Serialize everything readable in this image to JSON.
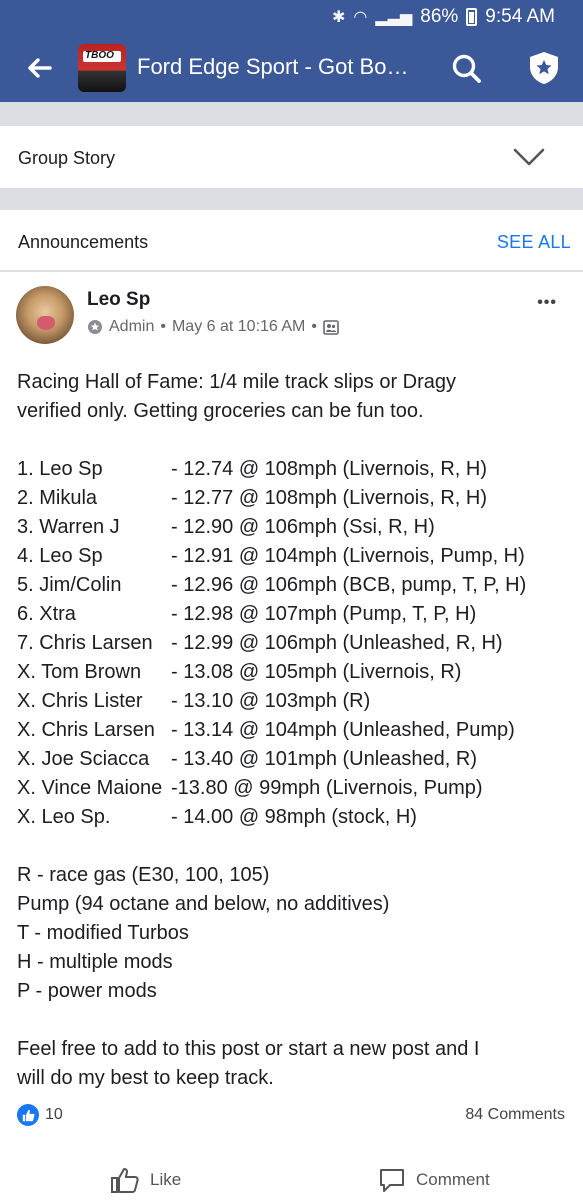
{
  "status_bar": {
    "battery": "86%",
    "time": "9:54 AM"
  },
  "header": {
    "title": "Ford Edge Sport - Got Bo…",
    "group_logo_text": "TBOO"
  },
  "group_story": {
    "label": "Group Story"
  },
  "announcements": {
    "label": "Announcements",
    "see_all": "SEE ALL"
  },
  "post": {
    "author": "Leo Sp",
    "role": "Admin",
    "separator": "•",
    "date": "May 6 at 10:16 AM",
    "more": "•••",
    "intro_1": "Racing Hall of Fame: 1/4 mile track slips or Dragy",
    "intro_2": "verified only. Getting groceries can be fun too.",
    "entries": [
      {
        "name": "1. Leo Sp",
        "result": "- 12.74 @ 108mph (Livernois, R, H)"
      },
      {
        "name": "2. Mikula",
        "result": "- 12.77 @ 108mph (Livernois, R, H)"
      },
      {
        "name": "3. Warren J",
        "result": "- 12.90 @ 106mph (Ssi, R, H)"
      },
      {
        "name": "4. Leo Sp",
        "result": "- 12.91 @ 104mph (Livernois, Pump, H)"
      },
      {
        "name": "5. Jim/Colin",
        "result": "- 12.96 @ 106mph (BCB, pump, T, P, H)"
      },
      {
        "name": "6. Xtra",
        "result": "- 12.98 @ 107mph (Pump, T, P, H)"
      },
      {
        "name": "7. Chris Larsen",
        "result": "- 12.99 @ 106mph (Unleashed, R, H)"
      },
      {
        "name": "X. Tom Brown",
        "result": "- 13.08 @ 105mph (Livernois, R)"
      },
      {
        "name": "X. Chris Lister",
        "result": "- 13.10 @ 103mph (R)"
      },
      {
        "name": "X. Chris Larsen",
        "result": "- 13.14 @ 104mph (Unleashed, Pump)"
      },
      {
        "name": "X. Joe Sciacca",
        "result": "- 13.40 @ 101mph (Unleashed, R)"
      },
      {
        "name": "X. Vince Maione",
        "result": "-13.80 @ 99mph (Livernois, Pump)"
      },
      {
        "name": "X. Leo Sp.",
        "result": "- 14.00 @ 98mph (stock, H)"
      }
    ],
    "legend": [
      "R - race gas (E30, 100, 105)",
      "Pump (94 octane and below, no additives)",
      "T - modified Turbos",
      "H - multiple mods",
      "P - power mods"
    ],
    "outro_1": "Feel free to add to this post or start a new post and I",
    "outro_2": "will do my best to keep track.",
    "like_count": "10",
    "comments_count": "84 Comments",
    "like_label": "Like",
    "comment_label": "Comment"
  },
  "icons": {
    "back": "arrow-left-icon",
    "search": "search-icon",
    "admin": "shield-star-icon",
    "dropdown": "chevron-down-icon",
    "privacy": "group-privacy-icon",
    "like": "thumbs-up-icon",
    "comment": "comment-icon"
  },
  "colors": {
    "brand": "#3b5998",
    "link": "#1877f2",
    "divider": "#dadde1"
  }
}
